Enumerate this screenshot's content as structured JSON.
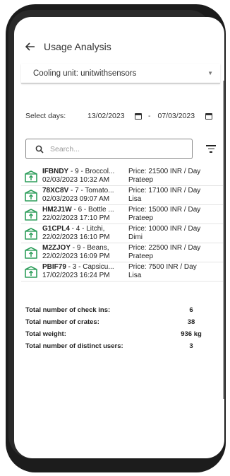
{
  "header": {
    "title": "Usage Analysis"
  },
  "cooling_unit": {
    "label": "Cooling unit: unitwithsensors"
  },
  "date_range": {
    "label": "Select days:",
    "start": "13/02/2023",
    "separator": "-",
    "end": "07/03/2023"
  },
  "search": {
    "placeholder": "Search..."
  },
  "checkins": [
    {
      "code": "IFBNDY",
      "desc": " - 9 - Broccol...",
      "datetime": "02/03/2023 10:32 AM",
      "price": "Price: 21500 INR / Day",
      "user": "Prateep"
    },
    {
      "code": "78XC8V",
      "desc": " - 7 - Tomato...",
      "datetime": "02/03/2023 09:07 AM",
      "price": "Price: 17100 INR / Day",
      "user": "Lisa"
    },
    {
      "code": "HM2J1W",
      "desc": " - 6 - Bottle ...",
      "datetime": "22/02/2023 17:10 PM",
      "price": "Price: 15000 INR / Day",
      "user": "Prateep"
    },
    {
      "code": "G1CPL4",
      "desc": " - 4 - Litchi,",
      "datetime": "22/02/2023 16:10 PM",
      "price": "Price: 10000 INR / Day",
      "user": "Dimi"
    },
    {
      "code": "M2ZJOY",
      "desc": " - 9 - Beans,",
      "datetime": "22/02/2023 16:09 PM",
      "price": "Price: 22500 INR / Day",
      "user": "Prateep"
    },
    {
      "code": "PBIF79",
      "desc": " - 3 - Capsicu...",
      "datetime": "17/02/2023 16:24 PM",
      "price": "Price: 7500 INR / Day",
      "user": "Lisa"
    }
  ],
  "totals": [
    {
      "label": "Total number of check ins:",
      "value": "6"
    },
    {
      "label": "Total number of crates:",
      "value": "38"
    },
    {
      "label": "Total weight:",
      "value": "936 kg"
    },
    {
      "label": "Total number of distinct users:",
      "value": "3"
    }
  ],
  "colors": {
    "crate_icon": "#2e9e5b",
    "frame": "#1c1c1c"
  }
}
